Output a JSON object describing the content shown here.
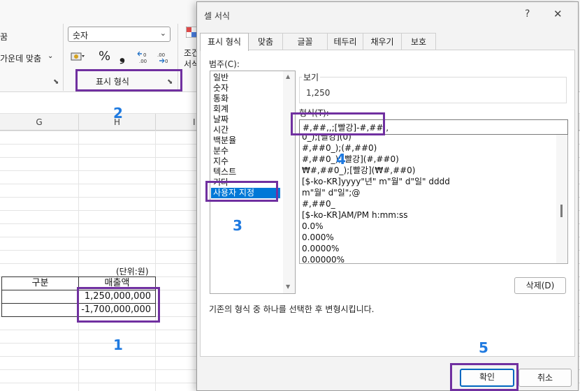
{
  "ribbon": {
    "left_label_1": "꿈",
    "left_label_2": "가운데 맞춤",
    "number_format_combo": "숫자",
    "percent_symbol": "%",
    "comma_symbol": "❟",
    "increase_decimal": "←.0\n.00",
    "decrease_decimal": ".00\n→.0",
    "group_label": "표시 형식",
    "cond_label_1": "조건",
    "cond_label_2": "서식"
  },
  "sheet": {
    "columns": [
      "G",
      "H",
      "I"
    ],
    "unit_note": "(단위:원)",
    "table_header_left": "구분",
    "table_header_right": "매출액",
    "row1_value": "1,250,000,000",
    "row2_value": "-1,700,000,000"
  },
  "annotations": [
    "1",
    "2",
    "3",
    "4",
    "5"
  ],
  "dialog": {
    "title": "셀 서식",
    "help": "?",
    "close": "✕",
    "tabs": [
      "표시 형식",
      "맞춤",
      "글꼴",
      "테두리",
      "채우기",
      "보호"
    ],
    "category_label": "범주(C):",
    "categories": [
      "일반",
      "숫자",
      "통화",
      "회계",
      "날짜",
      "시간",
      "백분율",
      "분수",
      "지수",
      "텍스트",
      "기타",
      "사용자 지정"
    ],
    "selected_category": "사용자 지정",
    "sample_label": "보기",
    "sample_value": "1,250",
    "type_label": "형식(T):",
    "type_value": "#,##,,;[빨강]-#,##,,",
    "format_list": [
      "0_);[빨강](0)",
      "#,##0_);(#,##0)",
      "#,##0_);[빨강](#,##0)",
      "₩#,##0_);[빨강](₩#,##0)",
      "[$-ko-KR]yyyy\"년\" m\"월\" d\"일\" dddd",
      "m\"월\" d\"일\";@",
      "#,##0_",
      "[$-ko-KR]AM/PM h:mm:ss",
      "0.0%",
      "0.000%",
      "0.0000%",
      "0.00000%"
    ],
    "delete_button": "삭제(D)",
    "description": "기존의 형식 중 하나를 선택한 후 변형시킵니다.",
    "ok_button": "확인",
    "cancel_button": "취소"
  },
  "colors": {
    "highlight": "#7030a0",
    "annotation": "#1f7ae0",
    "selection": "#0078d7"
  }
}
